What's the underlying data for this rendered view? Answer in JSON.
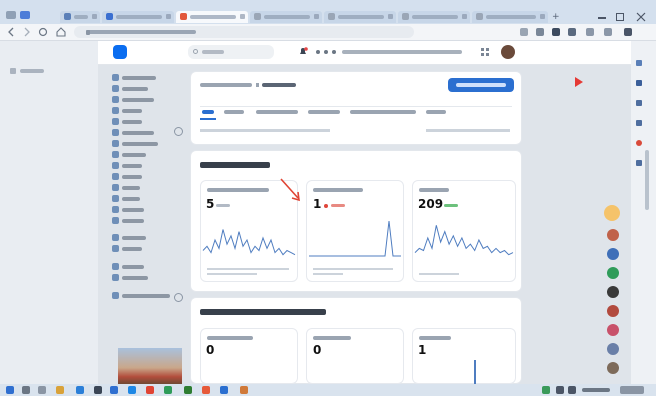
{
  "app": {
    "brand_name": "",
    "accent_color": "#2b6fd0",
    "logo_letter": "",
    "logo_color": "#0a6df0"
  },
  "stats": {
    "title": "",
    "cards": [
      {
        "value": "5",
        "delta": "",
        "delta_color": "#7a8592"
      },
      {
        "value": "1",
        "delta": "",
        "delta_color": "#e0463b"
      },
      {
        "value": "209",
        "delta": "",
        "delta_color": "#35a853"
      }
    ]
  },
  "contacts": {
    "title": "",
    "cards": [
      {
        "value": "0"
      },
      {
        "value": "0"
      },
      {
        "value": "1"
      }
    ]
  },
  "annotation": {
    "arrow_color": "#e04434",
    "cursor_color": "#e53935"
  }
}
